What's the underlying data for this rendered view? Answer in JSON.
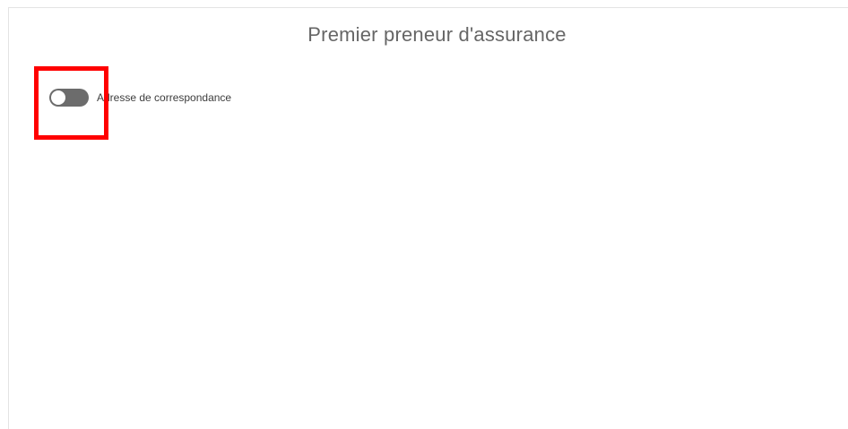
{
  "panel": {
    "title": "Premier preneur d'assurance"
  },
  "toggle": {
    "label": "Adresse de correspondance",
    "state": "off"
  },
  "colors": {
    "highlight": "#ff0000",
    "toggle_track": "#6c6c6c",
    "toggle_knob": "#ffffff",
    "title_text": "#666666"
  }
}
